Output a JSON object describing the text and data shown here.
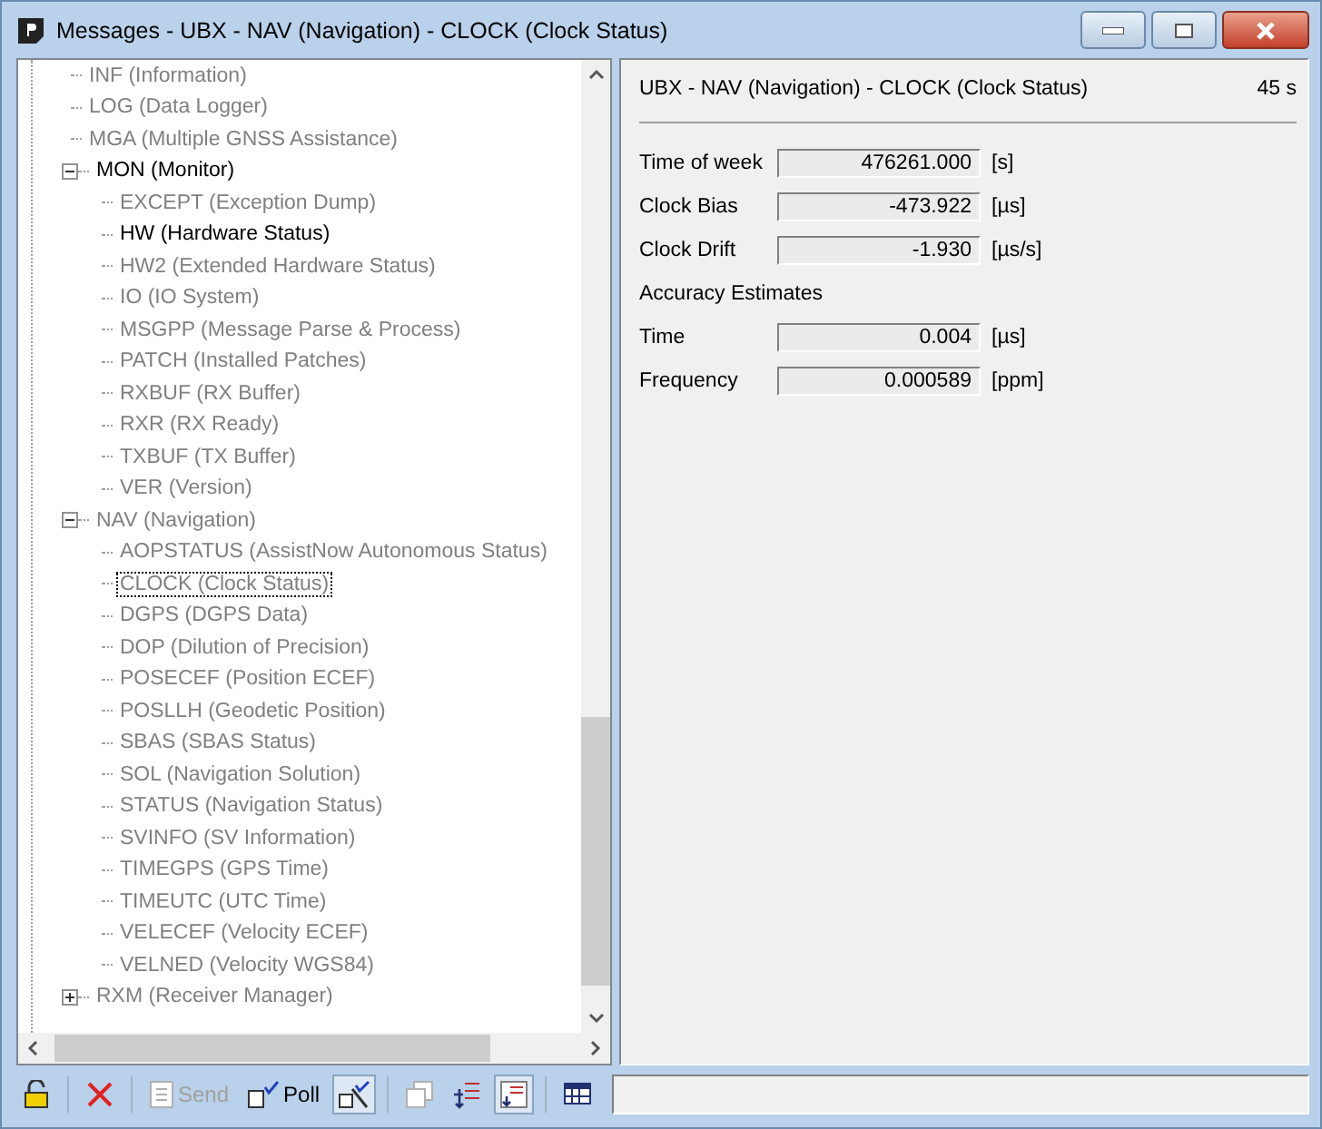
{
  "window": {
    "title": "Messages - UBX - NAV (Navigation) - CLOCK (Clock Status)"
  },
  "tree": [
    {
      "label": "INF (Information)",
      "active": false,
      "selected": false
    },
    {
      "label": "LOG (Data Logger)",
      "active": false,
      "selected": false
    },
    {
      "label": "MGA (Multiple GNSS Assistance)",
      "active": false,
      "selected": false
    },
    {
      "label": "MON (Monitor)",
      "active": true,
      "selected": false,
      "expanded": true,
      "children": [
        {
          "label": "EXCEPT (Exception Dump)",
          "active": false,
          "selected": false
        },
        {
          "label": "HW (Hardware Status)",
          "active": true,
          "selected": false
        },
        {
          "label": "HW2 (Extended Hardware Status)",
          "active": false,
          "selected": false
        },
        {
          "label": "IO (IO System)",
          "active": false,
          "selected": false
        },
        {
          "label": "MSGPP (Message Parse & Process)",
          "active": false,
          "selected": false
        },
        {
          "label": "PATCH (Installed Patches)",
          "active": false,
          "selected": false
        },
        {
          "label": "RXBUF (RX Buffer)",
          "active": false,
          "selected": false
        },
        {
          "label": "RXR (RX Ready)",
          "active": false,
          "selected": false
        },
        {
          "label": "TXBUF (TX Buffer)",
          "active": false,
          "selected": false
        },
        {
          "label": "VER (Version)",
          "active": false,
          "selected": false
        }
      ]
    },
    {
      "label": "NAV (Navigation)",
      "active": false,
      "selected": false,
      "expanded": true,
      "children": [
        {
          "label": "AOPSTATUS (AssistNow Autonomous Status)",
          "active": false,
          "selected": false
        },
        {
          "label": "CLOCK (Clock Status)",
          "active": false,
          "selected": true
        },
        {
          "label": "DGPS (DGPS Data)",
          "active": false,
          "selected": false
        },
        {
          "label": "DOP (Dilution of Precision)",
          "active": false,
          "selected": false
        },
        {
          "label": "POSECEF (Position ECEF)",
          "active": false,
          "selected": false
        },
        {
          "label": "POSLLH (Geodetic Position)",
          "active": false,
          "selected": false
        },
        {
          "label": "SBAS (SBAS Status)",
          "active": false,
          "selected": false
        },
        {
          "label": "SOL (Navigation Solution)",
          "active": false,
          "selected": false
        },
        {
          "label": "STATUS (Navigation Status)",
          "active": false,
          "selected": false
        },
        {
          "label": "SVINFO (SV Information)",
          "active": false,
          "selected": false
        },
        {
          "label": "TIMEGPS (GPS Time)",
          "active": false,
          "selected": false
        },
        {
          "label": "TIMEUTC (UTC Time)",
          "active": false,
          "selected": false
        },
        {
          "label": "VELECEF (Velocity ECEF)",
          "active": false,
          "selected": false
        },
        {
          "label": "VELNED (Velocity WGS84)",
          "active": false,
          "selected": false
        }
      ]
    },
    {
      "label": "RXM (Receiver Manager)",
      "active": false,
      "selected": false,
      "expanded": false
    }
  ],
  "panel": {
    "heading": "UBX - NAV (Navigation) - CLOCK (Clock Status)",
    "age": "45 s",
    "rows": [
      {
        "kind": "field",
        "label": "Time of week",
        "value": "476261.000",
        "unit": "[s]"
      },
      {
        "kind": "field",
        "label": "Clock Bias",
        "value": "-473.922",
        "unit": "[µs]"
      },
      {
        "kind": "field",
        "label": "Clock Drift",
        "value": "-1.930",
        "unit": "[µs/s]"
      },
      {
        "kind": "heading",
        "label": "Accuracy Estimates"
      },
      {
        "kind": "field",
        "label": "Time",
        "value": "0.004",
        "unit": "[µs]"
      },
      {
        "kind": "field",
        "label": "Frequency",
        "value": "0.000589",
        "unit": "[ppm]"
      }
    ]
  },
  "toolbar": [
    {
      "kind": "lock"
    },
    {
      "kind": "sep"
    },
    {
      "kind": "delete"
    },
    {
      "kind": "sep"
    },
    {
      "kind": "send",
      "label": "Send",
      "disabled": true
    },
    {
      "kind": "poll",
      "label": "Poll",
      "disabled": false
    },
    {
      "kind": "wand",
      "pressed": true
    },
    {
      "kind": "sep"
    },
    {
      "kind": "copy",
      "disabled": true
    },
    {
      "kind": "list-in",
      "pressed": false
    },
    {
      "kind": "list-down",
      "pressed": true
    },
    {
      "kind": "sep"
    },
    {
      "kind": "grid",
      "pressed": false
    }
  ]
}
